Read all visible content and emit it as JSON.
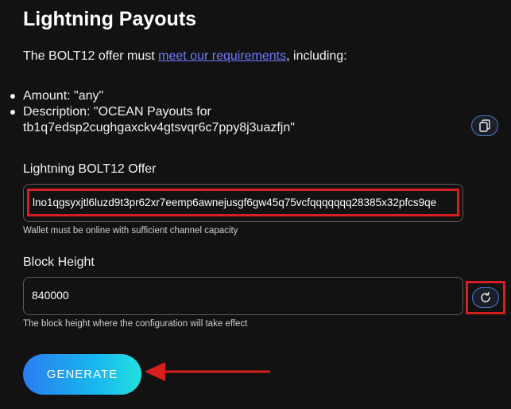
{
  "page": {
    "title": "Lightning Payouts",
    "intro_prefix": "The BOLT12 offer must ",
    "intro_link": "meet our requirements",
    "intro_suffix": ", including:",
    "requirements": [
      "Amount: \"any\"",
      "Description: \"OCEAN Payouts for tb1q7edsp2cughgaxckv4gtsvqr6c7ppy8j3uazfjn\""
    ]
  },
  "offer": {
    "label": "Lightning BOLT12 Offer",
    "value": "lno1qgsyxjtl6luzd9t3pr62xr7eemp6awnejusgf6gw45q75vcfqqqqqqq28385x32pfcs9qe",
    "hint": "Wallet must be online with sufficient channel capacity"
  },
  "block_height": {
    "label": "Block Height",
    "value": "840000",
    "hint": "The block height where the configuration will take effect"
  },
  "actions": {
    "generate_label": "GENERATE",
    "copy_icon": "copy-icon",
    "refresh_icon": "refresh-icon"
  },
  "colors": {
    "background": "#121212",
    "link": "#6f7cff",
    "highlight_red": "#d81f1f",
    "button_gradient_start": "#2a7df0",
    "button_gradient_end": "#22e0dd"
  }
}
